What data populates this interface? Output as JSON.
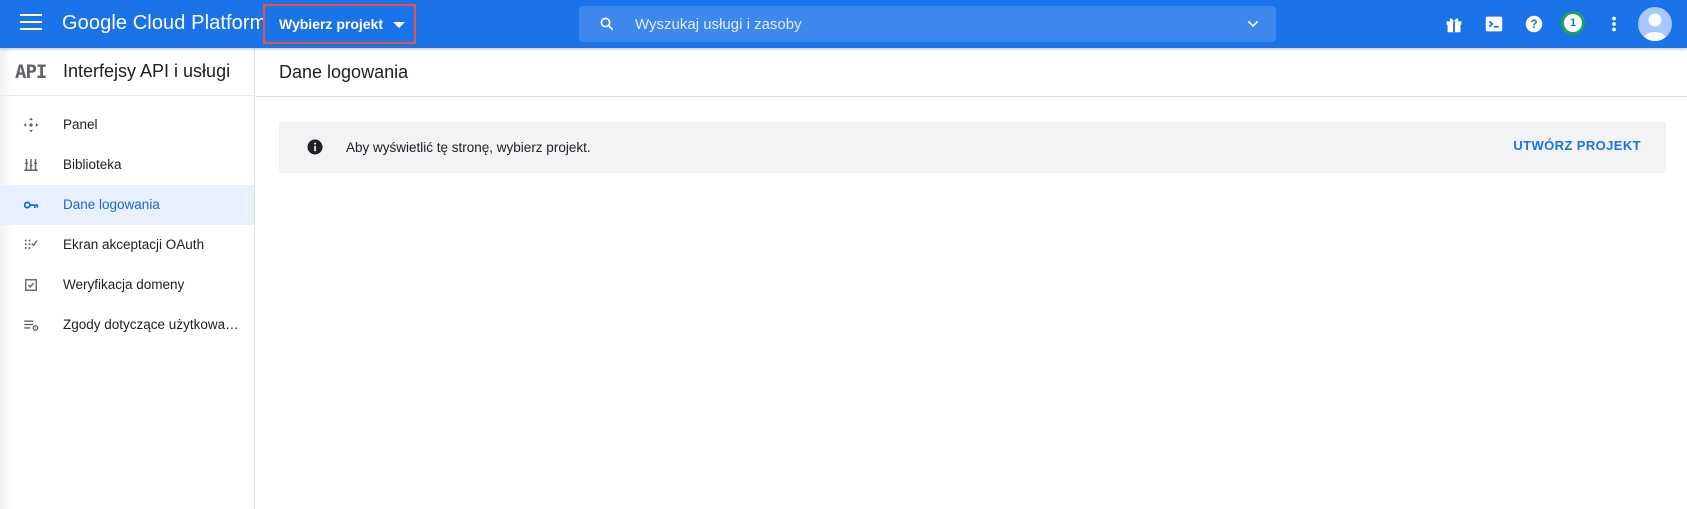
{
  "topbar": {
    "brand": "Google Cloud Platform",
    "project_selector": "Wybierz projekt",
    "search_placeholder": "Wyszukaj usługi i zasoby",
    "notification_count": "1",
    "color": "#1a73e8"
  },
  "sidebar": {
    "logo": "API",
    "title": "Interfejsy API i usługi",
    "items": [
      {
        "label": "Panel",
        "icon": "dashboard-icon"
      },
      {
        "label": "Biblioteka",
        "icon": "library-icon"
      },
      {
        "label": "Dane logowania",
        "icon": "key-icon",
        "active": true
      },
      {
        "label": "Ekran akceptacji OAuth",
        "icon": "oauth-consent-icon"
      },
      {
        "label": "Weryfikacja domeny",
        "icon": "checkbox-icon"
      },
      {
        "label": "Zgody dotyczące użytkowan…",
        "icon": "list-settings-icon"
      }
    ]
  },
  "main": {
    "title": "Dane logowania",
    "notice": {
      "message": "Aby wyświetlić tę stronę, wybierz projekt.",
      "action": "UTWÓRZ PROJEKT"
    }
  }
}
